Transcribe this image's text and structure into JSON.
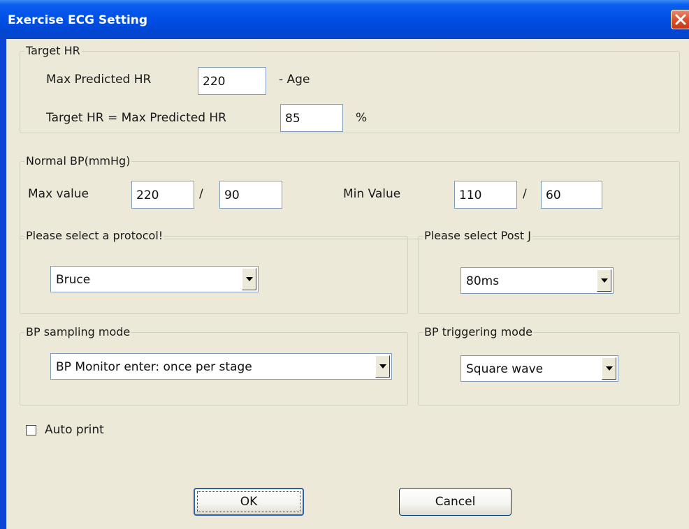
{
  "window": {
    "title": "Exercise ECG Setting",
    "close_icon": "close-icon"
  },
  "target_hr": {
    "legend": "Target HR",
    "max_pred_label": "Max Predicted HR",
    "max_pred_value": "220",
    "age_label": "- Age",
    "target_label": "Target HR = Max Predicted HR",
    "target_value": "85",
    "percent_label": "%"
  },
  "normal_bp": {
    "legend": "Normal BP(mmHg)",
    "max_label": "Max value",
    "max_sys": "220",
    "max_dia": "90",
    "slash": "/",
    "min_label": "Min Value",
    "min_sys": "110",
    "min_dia": "60"
  },
  "protocol": {
    "legend": "Please select a protocol!",
    "selected": "Bruce"
  },
  "post_j": {
    "legend": "Please select Post J",
    "selected": "80ms"
  },
  "bp_sampling": {
    "legend": "BP sampling mode",
    "selected": "BP Monitor enter: once per stage"
  },
  "bp_triggering": {
    "legend": "BP triggering mode",
    "selected": "Square wave"
  },
  "auto_print": {
    "label": "Auto print",
    "checked": false
  },
  "buttons": {
    "ok": "OK",
    "cancel": "Cancel"
  },
  "colors": {
    "titlebar": "#0050e6",
    "client": "#ece9d8",
    "close": "#d9522c"
  }
}
